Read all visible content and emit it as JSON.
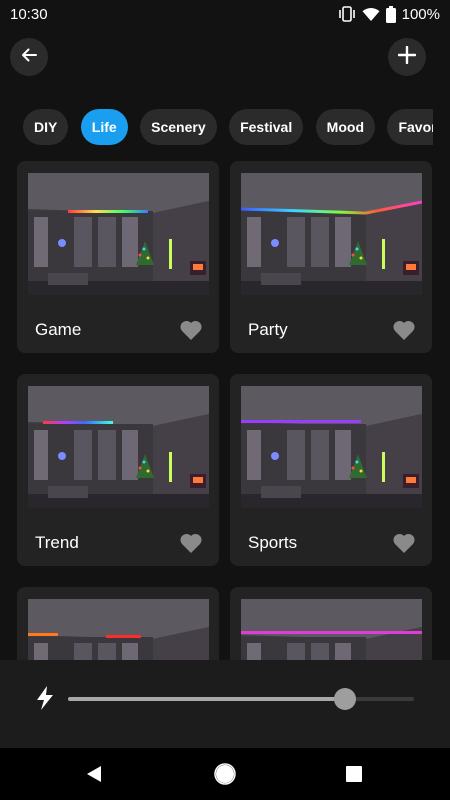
{
  "status_bar": {
    "time": "10:30",
    "battery": "100%",
    "icons": [
      "vibrate-icon",
      "wifi-icon",
      "battery-icon"
    ]
  },
  "top_bar": {
    "back_icon": "arrow-left-icon",
    "add_icon": "plus-icon"
  },
  "tabs": [
    {
      "label": "DIY",
      "active": false
    },
    {
      "label": "Life",
      "active": true
    },
    {
      "label": "Scenery",
      "active": false
    },
    {
      "label": "Festival",
      "active": false
    },
    {
      "label": "Mood",
      "active": false
    },
    {
      "label": "Favorite",
      "active": false
    }
  ],
  "scenes": [
    {
      "label": "Game",
      "favorite": false,
      "light": "multicolor-left"
    },
    {
      "label": "Party",
      "favorite": false,
      "light": "rainbow-full"
    },
    {
      "label": "Trend",
      "favorite": false,
      "light": "rainbow-left"
    },
    {
      "label": "Sports",
      "favorite": false,
      "light": "purple"
    },
    {
      "label": "",
      "favorite": false,
      "light": "orange-red"
    },
    {
      "label": "",
      "favorite": false,
      "light": "magenta"
    }
  ],
  "brightness": {
    "icon": "bolt-icon",
    "value_percent": 80
  },
  "nav": {
    "back_icon": "triangle-back-icon",
    "home_icon": "circle-home-icon",
    "recents_icon": "square-recents-icon"
  },
  "colors": {
    "accent": "#1a9ff0",
    "background": "#121212",
    "card": "#232323",
    "chip": "#2b2b2b"
  }
}
